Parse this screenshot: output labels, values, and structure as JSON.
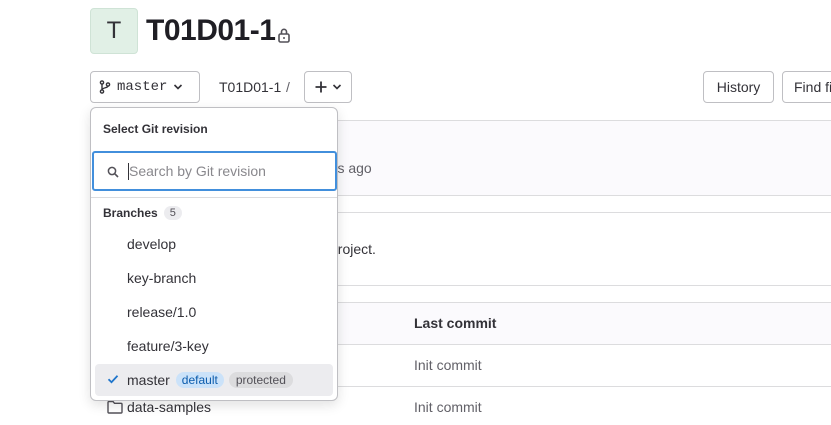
{
  "project": {
    "avatar_letter": "T",
    "title": "T01D01-1"
  },
  "toolbar": {
    "branch_label": "master",
    "breadcrumb_project": "T01D01-1",
    "breadcrumb_separator": "/",
    "history_label": "History",
    "find_file_label": "Find file"
  },
  "background": {
    "last_updated": "nths ago",
    "description_text": "project.",
    "column_last_commit": "Last commit",
    "rows": [
      {
        "commit": "Init commit"
      },
      {
        "name": "data-samples",
        "commit": "Init commit"
      }
    ]
  },
  "dropdown": {
    "title": "Select Git revision",
    "search_placeholder": "Search by Git revision",
    "search_value": "",
    "group_label": "Branches",
    "group_count": "5",
    "branches": [
      {
        "name": "develop"
      },
      {
        "name": "key-branch"
      },
      {
        "name": "release/1.0"
      },
      {
        "name": "feature/3-key"
      },
      {
        "name": "master",
        "badge_default": "default",
        "badge_protected": "protected",
        "selected": true
      }
    ]
  },
  "colors": {
    "accent_focus": "#428fdc",
    "badge_default_bg": "#cbe2f9",
    "badge_default_text": "#0b5cad"
  },
  "icons": {
    "branch": "branch-icon",
    "lock": "lock-icon",
    "search": "search-icon",
    "check": "check-icon",
    "folder": "folder-icon",
    "plus": "plus-icon",
    "chevron": "chevron-down-icon"
  }
}
